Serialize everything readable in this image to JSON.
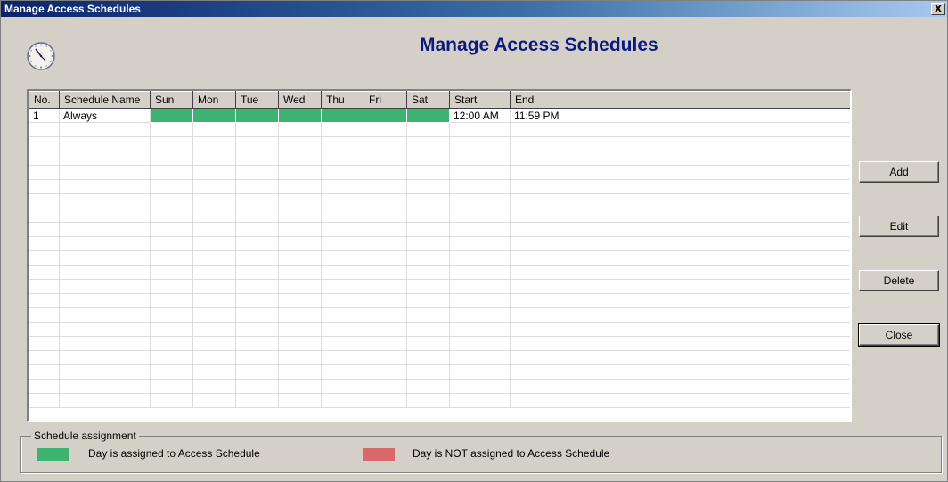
{
  "window": {
    "title": "Manage Access Schedules",
    "close_glyph": "x"
  },
  "header": {
    "title": "Manage Access Schedules",
    "icon": "clock-icon"
  },
  "grid": {
    "columns": [
      "No.",
      "Schedule Name",
      "Sun",
      "Mon",
      "Tue",
      "Wed",
      "Thu",
      "Fri",
      "Sat",
      "Start",
      "End"
    ],
    "rows": [
      {
        "no": "1",
        "name": "Always",
        "days": [
          true,
          true,
          true,
          true,
          true,
          true,
          true
        ],
        "start": "12:00 AM",
        "end": "11:59 PM"
      }
    ]
  },
  "buttons": {
    "add": "Add",
    "edit": "Edit",
    "delete": "Delete",
    "close": "Close"
  },
  "legend": {
    "title": "Schedule assignment",
    "assigned": "Day is assigned to Access Schedule",
    "not_assigned": "Day is NOT assigned to Access Schedule",
    "assigned_color": "#3cb371",
    "not_assigned_color": "#d9686a"
  },
  "colors": {
    "heading": "#0a1a80",
    "titlebar_start": "#0a246a",
    "titlebar_end": "#a6caf0"
  }
}
